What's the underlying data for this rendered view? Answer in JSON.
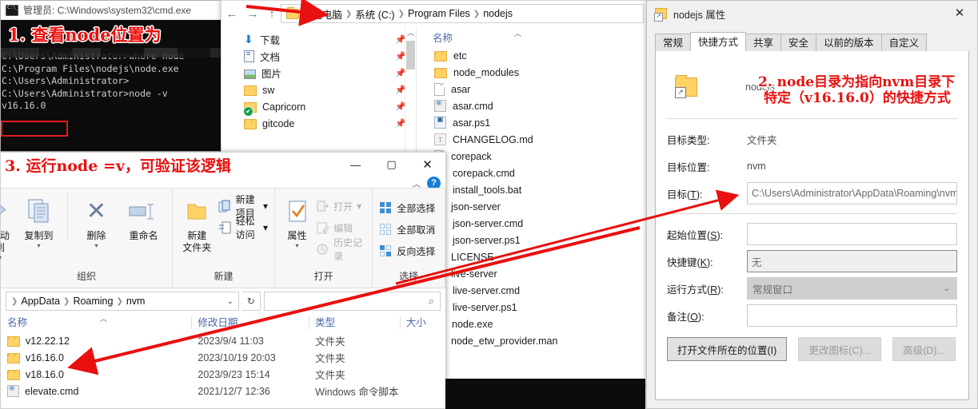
{
  "cmd": {
    "title": "管理员: C:\\Windows\\system32\\cmd.exe",
    "icon": "console-icon",
    "lines": [
      "C:\\Users\\Administrator>where node",
      "C:\\Program Files\\nodejs\\node.exe",
      "",
      "C:\\Users\\Administrator>",
      "C:\\Users\\Administrator>node -v",
      "v16.16.0"
    ],
    "highlighted_output": "v16.16.0"
  },
  "annotations": [
    {
      "id": "annot-1",
      "text": "1.  查看node位置为"
    },
    {
      "id": "annot-2",
      "text": "2.  node目录为指向nvm目录下"
    },
    {
      "id": "annot-2b",
      "text": "特定（v16.16.0）的快捷方式"
    },
    {
      "id": "annot-3",
      "text": "3.  运行node =v，可验证该逻辑"
    }
  ],
  "explorer_top": {
    "back_icon": "back-arrow-icon",
    "forward_icon": "forward-arrow-icon",
    "up_icon": "up-arrow-icon",
    "breadcrumb": [
      "此电脑",
      "系统 (C:)",
      "Program Files",
      "nodejs"
    ],
    "nav_pane": [
      {
        "label": "下载",
        "icon": "download-icon"
      },
      {
        "label": "文档",
        "icon": "documents-icon"
      },
      {
        "label": "图片",
        "icon": "pictures-icon"
      },
      {
        "label": "sw",
        "icon": "folder-icon"
      },
      {
        "label": "Capricorn",
        "icon": "folder-sync-icon"
      },
      {
        "label": "gitcode",
        "icon": "folder-icon"
      }
    ],
    "column_header": "名称",
    "files": [
      {
        "name": "etc",
        "icon": "folder-icon"
      },
      {
        "name": "node_modules",
        "icon": "folder-icon"
      },
      {
        "name": "asar",
        "icon": "file-icon"
      },
      {
        "name": "asar.cmd",
        "icon": "cmd-script-icon"
      },
      {
        "name": "asar.ps1",
        "icon": "powershell-script-icon"
      },
      {
        "name": "CHANGELOG.md",
        "icon": "markdown-file-icon"
      },
      {
        "name": "corepack",
        "icon": "file-icon"
      },
      {
        "name": "corepack.cmd",
        "icon": "cmd-script-icon"
      },
      {
        "name": "install_tools.bat",
        "icon": "cmd-script-icon"
      },
      {
        "name": "json-server",
        "icon": "file-icon"
      },
      {
        "name": "json-server.cmd",
        "icon": "cmd-script-icon"
      },
      {
        "name": "json-server.ps1",
        "icon": "powershell-script-icon"
      },
      {
        "name": "LICENSE",
        "icon": "file-icon"
      },
      {
        "name": "live-server",
        "icon": "file-icon"
      },
      {
        "name": "live-server.cmd",
        "icon": "cmd-script-icon"
      },
      {
        "name": "live-server.ps1",
        "icon": "powershell-script-icon"
      },
      {
        "name": "node.exe",
        "icon": "nodejs-icon"
      },
      {
        "name": "node_etw_provider.man",
        "icon": "file-icon"
      }
    ]
  },
  "explorer_bottom": {
    "window_buttons": {
      "minimize": "—",
      "maximize": "▢",
      "close": "✕"
    },
    "collapse_icon": "chevron-up-icon",
    "help_icon": "help-icon",
    "ribbon": [
      {
        "group_label": "组织",
        "big_buttons": [
          {
            "label": "移动到",
            "icon": "move-to-icon",
            "has_caret": true,
            "truncated": true
          },
          {
            "label": "复制到",
            "icon": "copy-to-icon",
            "has_caret": true
          },
          {
            "label": "删除",
            "icon": "delete-icon",
            "has_caret": true
          },
          {
            "label": "重命名",
            "icon": "rename-icon",
            "has_caret": false
          }
        ],
        "small_buttons": []
      },
      {
        "group_label": "新建",
        "big_buttons": [
          {
            "label": "新建\n文件夹",
            "icon": "new-folder-icon",
            "has_caret": false
          }
        ],
        "small_buttons": [
          {
            "label": "新建项目",
            "icon": "new-item-icon",
            "has_caret": true,
            "dim": false
          },
          {
            "label": "轻松访问",
            "icon": "easy-access-icon",
            "has_caret": true,
            "dim": false
          }
        ]
      },
      {
        "group_label": "打开",
        "big_buttons": [
          {
            "label": "属性",
            "icon": "properties-icon",
            "has_caret": true
          }
        ],
        "small_buttons": [
          {
            "label": "打开",
            "icon": "open-icon",
            "has_caret": true,
            "dim": true
          },
          {
            "label": "编辑",
            "icon": "edit-icon",
            "has_caret": false,
            "dim": true
          },
          {
            "label": "历史记录",
            "icon": "history-icon",
            "has_caret": false,
            "dim": true
          }
        ]
      },
      {
        "group_label": "选择",
        "big_buttons": [],
        "small_buttons": [
          {
            "label": "全部选择",
            "icon": "select-all-icon",
            "has_caret": false,
            "dim": false
          },
          {
            "label": "全部取消",
            "icon": "select-none-icon",
            "has_caret": false,
            "dim": false
          },
          {
            "label": "反向选择",
            "icon": "invert-selection-icon",
            "has_caret": false,
            "dim": false
          }
        ]
      }
    ],
    "breadcrumb": [
      "AppData",
      "Roaming",
      "nvm"
    ],
    "breadcrumb_dropdown_icon": "chevron-down-icon",
    "refresh_icon": "refresh-icon",
    "search_placeholder": "",
    "search_icon": "search-icon",
    "columns": [
      "名称",
      "修改日期",
      "类型",
      "大小"
    ],
    "rows": [
      {
        "name": "v12.22.12",
        "date": "2023/9/4 11:03",
        "type": "文件夹",
        "size": "",
        "icon": "folder-icon"
      },
      {
        "name": "v16.16.0",
        "date": "2023/10/19 20:03",
        "type": "文件夹",
        "size": "",
        "icon": "folder-icon"
      },
      {
        "name": "v18.16.0",
        "date": "2023/9/23 15:14",
        "type": "文件夹",
        "size": "",
        "icon": "folder-icon"
      },
      {
        "name": "elevate.cmd",
        "date": "2021/12/7 12:36",
        "type": "Windows 命令脚本",
        "size": "",
        "icon": "cmd-script-icon"
      }
    ]
  },
  "properties": {
    "title": "nodejs 属性",
    "title_icon": "shortcut-folder-icon",
    "close_icon": "close-icon",
    "tabs": [
      "常规",
      "快捷方式",
      "共享",
      "安全",
      "以前的版本",
      "自定义"
    ],
    "active_tab": "快捷方式",
    "shortcut_name": "nodejs",
    "fields": [
      {
        "label": "目标类型:",
        "value": "文件夹",
        "kind": "static"
      },
      {
        "label": "目标位置:",
        "value": "nvm",
        "kind": "static"
      },
      {
        "label": "目标(T):",
        "value": "C:\\Users\\Administrator\\AppData\\Roaming\\nvm",
        "kind": "input",
        "accesskey": "T"
      },
      {
        "label": "起始位置(S):",
        "value": "",
        "kind": "input",
        "accesskey": "S"
      },
      {
        "label": "快捷键(K):",
        "value": "无",
        "kind": "readonly",
        "accesskey": "K"
      },
      {
        "label": "运行方式(R):",
        "value": "常规窗口",
        "kind": "select",
        "accesskey": "R"
      },
      {
        "label": "备注(O):",
        "value": "",
        "kind": "input",
        "accesskey": "O"
      }
    ],
    "buttons": [
      {
        "label": "打开文件所在的位置(I)",
        "disabled": false
      },
      {
        "label": "更改图标(C)...",
        "disabled": true
      },
      {
        "label": "高级(D)...",
        "disabled": true
      }
    ]
  },
  "colors": {
    "annotation_red": "#e8110f",
    "console_bg": "#0c0c0c",
    "console_fg": "#cccccc",
    "accent_blue": "#1a7fd4",
    "folder_yellow": "#ffd264"
  }
}
